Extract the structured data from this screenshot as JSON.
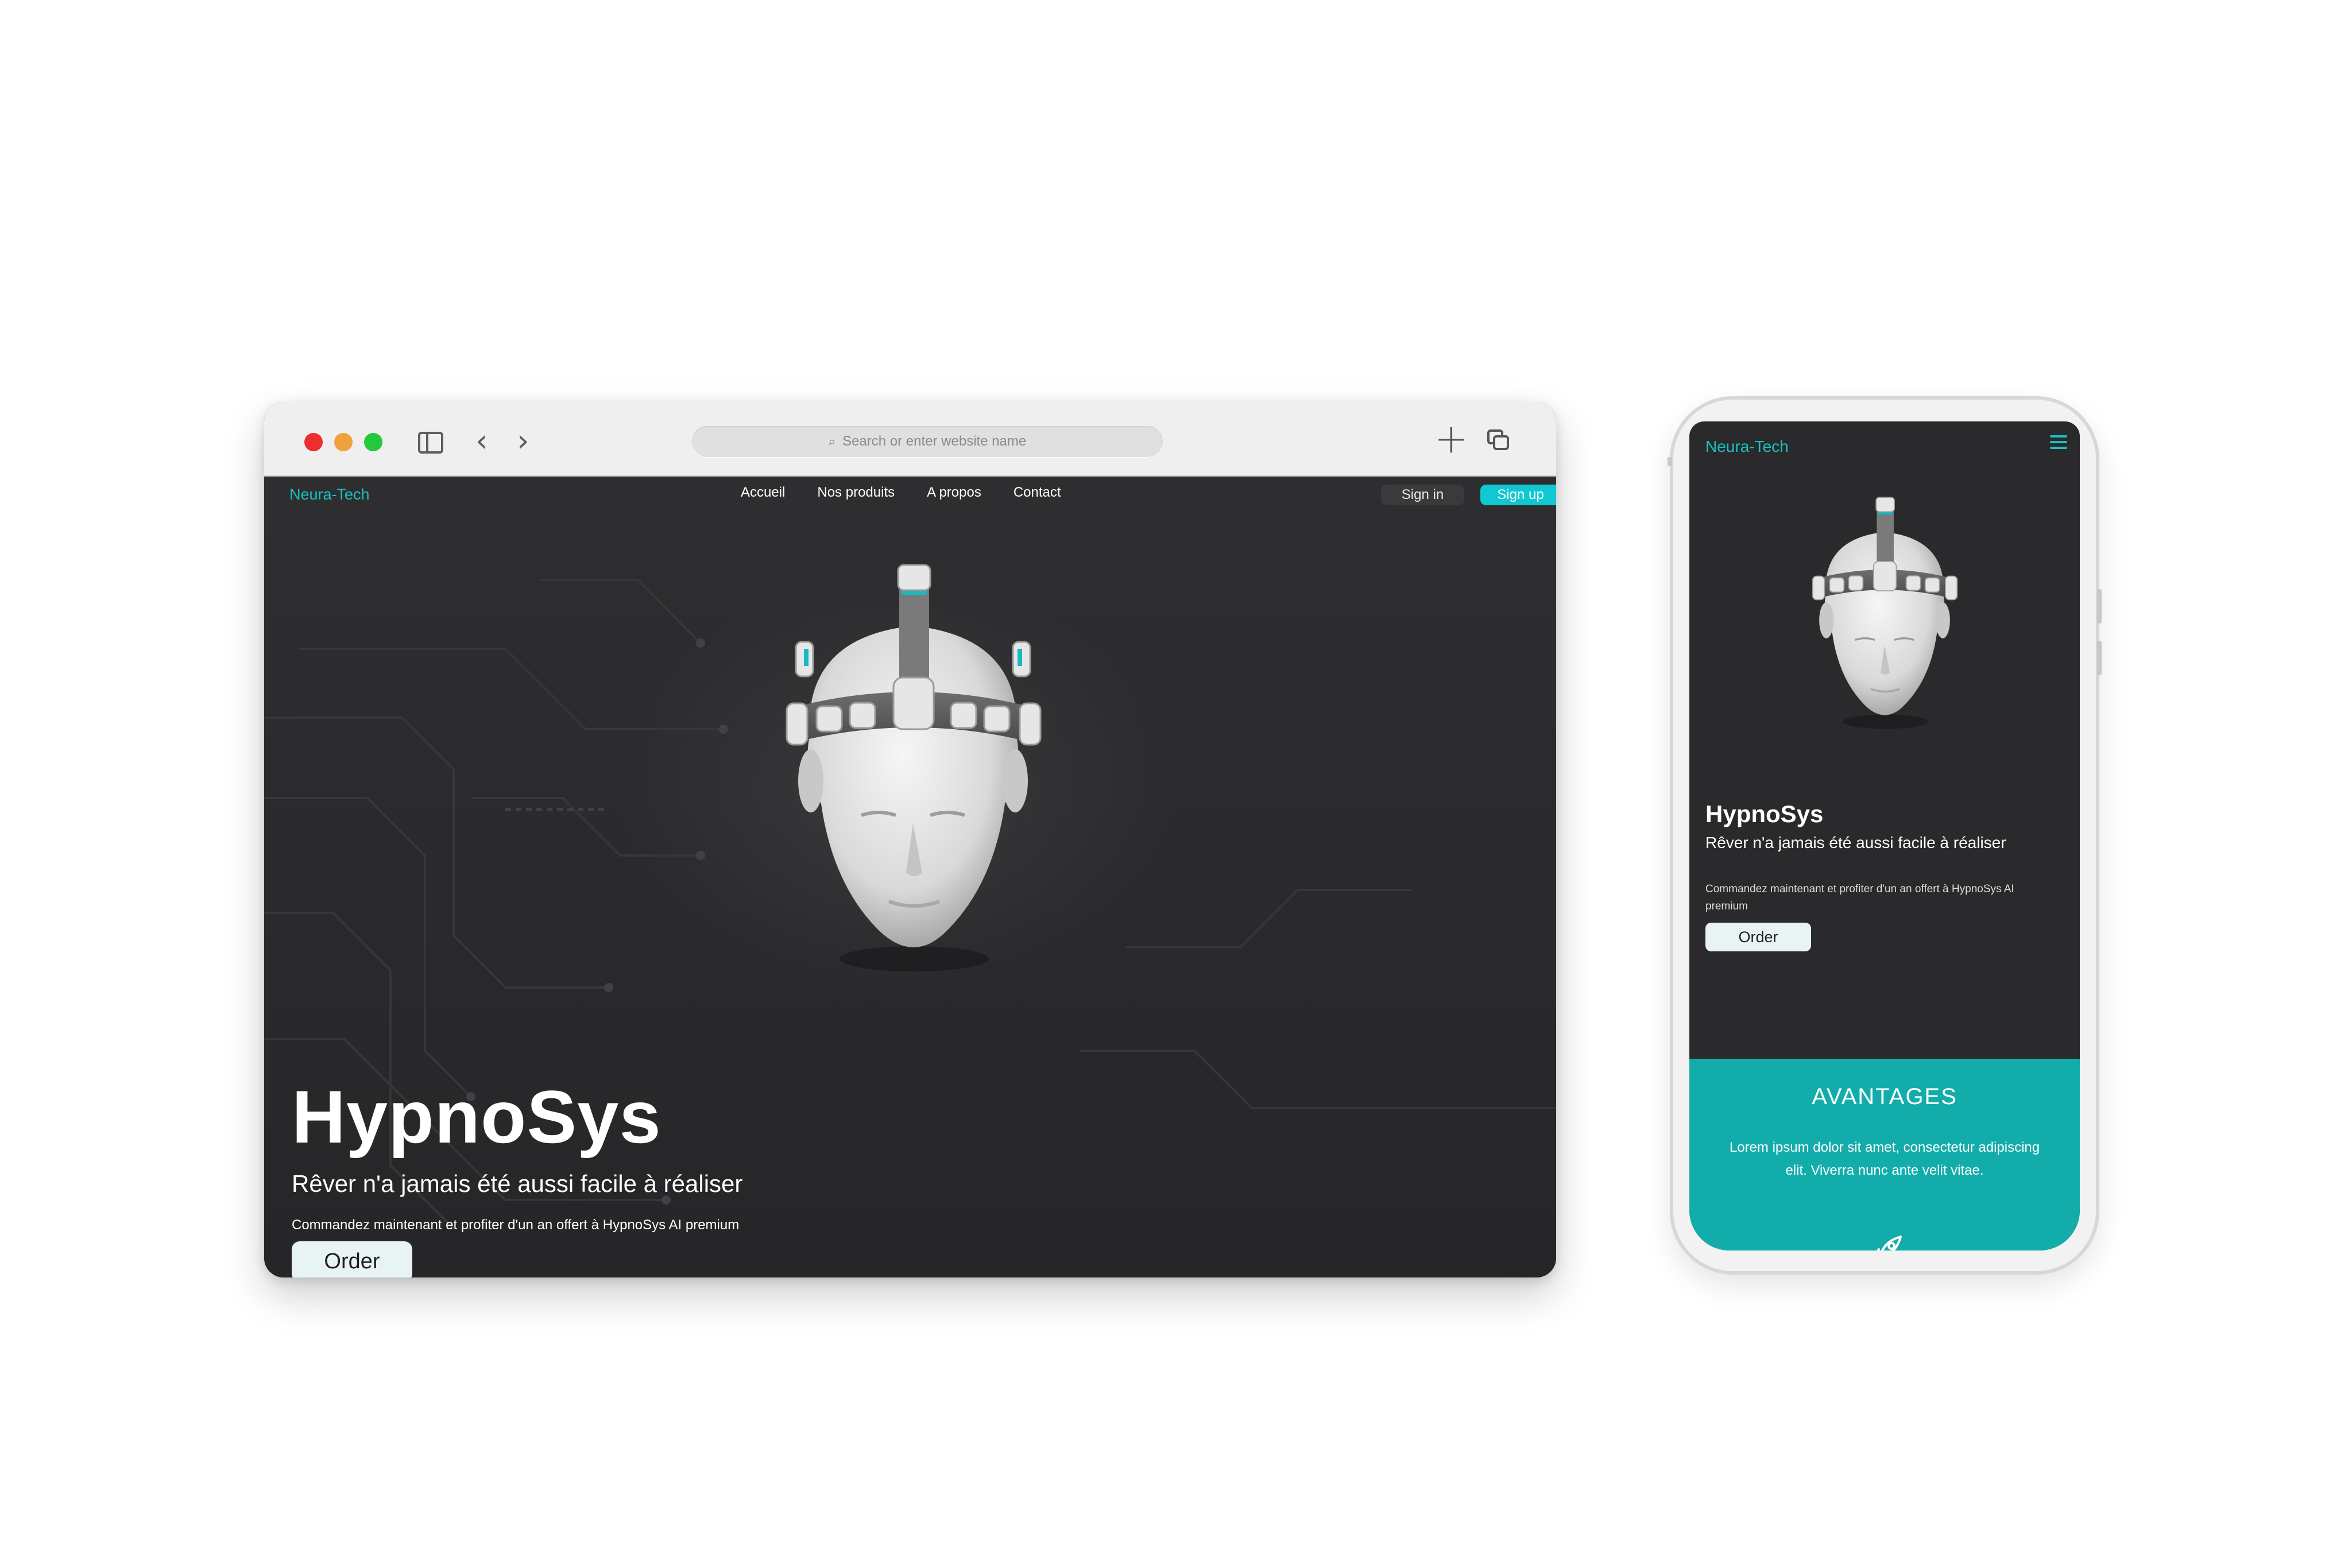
{
  "desktop": {
    "address_placeholder": "Search or enter website name",
    "brand": "Neura-Tech",
    "nav": [
      "Accueil",
      "Nos produits",
      "A propos",
      "Contact"
    ],
    "signin_label": "Sign in",
    "signup_label": "Sign up",
    "hero": {
      "title": "HypnoSys",
      "tagline": "Rêver n'a jamais été aussi facile à réaliser",
      "subtext": "Commandez maintenant et profiter d'un an offert à HypnoSys AI premium",
      "order_label": "Order"
    }
  },
  "mobile": {
    "brand": "Neura-Tech",
    "hero": {
      "title": "HypnoSys",
      "tagline": "Rêver n'a jamais été aussi facile à réaliser",
      "subtext": "Commandez maintenant et profiter d'un an offert à HypnoSys AI premium",
      "order_label": "Order"
    },
    "avantages": {
      "title": "AVANTAGES",
      "body": "Lorem ipsum dolor sit amet, consectetur adipiscing elit. Viverra nunc ante velit vitae."
    }
  },
  "colors": {
    "accent": "#10c8d2",
    "brand_text": "#19c1c1",
    "teal_section": "#12adab",
    "dark_bg": "#2a2a2c"
  },
  "icons": [
    "search-icon",
    "sidebar-toggle-icon",
    "back-icon",
    "forward-icon",
    "new-tab-icon",
    "tabs-icon",
    "hamburger-menu-icon",
    "rocket-icon"
  ]
}
